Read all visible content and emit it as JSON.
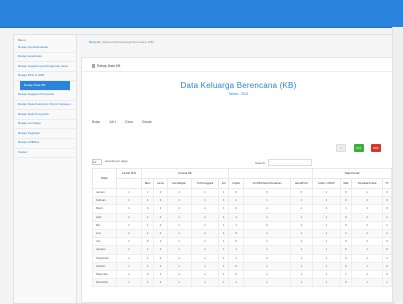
{
  "breadcrumb": {
    "home": "Beranda",
    "current": "Rekap Data Keluarga Berencana (KB)"
  },
  "panel": {
    "header": "Rekap Data KB"
  },
  "title": "Data Keluarga Berencana (KB)",
  "subtitle": "Tahun : 2011",
  "filters": {
    "bulan_label": "Bulan",
    "bulan_value": "Juli 1",
    "desa_label": "Desa",
    "desa_value": "Tokoak"
  },
  "buttons": {
    "xls": "XLS",
    "pdf": "PDF"
  },
  "tools": {
    "per_page_value": "10",
    "per_page_label": "records per page",
    "search_label": "Search:"
  },
  "sidebar": {
    "title": "Menu",
    "items": [
      {
        "label": "Rekap pendududukan"
      },
      {
        "label": "Rekap kesehatan"
      },
      {
        "label": "Rekap kegiatan pembangunan desa"
      },
      {
        "label": "Rekap PKK & LPM"
      },
      {
        "label": "Rekap Data KB"
      },
      {
        "label": "Rekap kegiatan Posyandu"
      },
      {
        "label": "Rekap Data Kelompok Tani & Nelayan"
      },
      {
        "label": "Rekap Data Posyandu"
      },
      {
        "label": "Rekap Lembaga"
      },
      {
        "label": "Rekap Kegiatan"
      },
      {
        "label": "Rekap APBDes"
      },
      {
        "label": "Keluar"
      }
    ]
  },
  "table": {
    "group_headers": [
      "Peserta KB",
      "Tidak Pernah"
    ],
    "columns": [
      "Bulan",
      "Jumlah PUS",
      "Baru",
      "Lama",
      "Kembaliyan",
      "Jml Pengganti",
      "Iud",
      "Implan",
      "Jml KB Pasca Persalinan",
      "Hamil/PUS",
      "Lebih + MKJP",
      "Wile",
      "Pemakai Kontra",
      "TT"
    ],
    "rows": [
      {
        "month": "Januari",
        "v": [
          "1",
          "1",
          "0",
          "1",
          "1",
          "1",
          "0",
          "0",
          "0",
          "1",
          "0",
          "1",
          "0"
        ]
      },
      {
        "month": "Februari",
        "v": [
          "1",
          "1",
          "0",
          "1",
          "1",
          "1",
          "1",
          "1",
          "1",
          "1",
          "0",
          "1",
          "0"
        ]
      },
      {
        "month": "Maret",
        "v": [
          "1",
          "0",
          "1",
          "1",
          "1",
          "1",
          "0",
          "1",
          "1",
          "1",
          "1",
          "1",
          "0"
        ]
      },
      {
        "month": "April",
        "v": [
          "1",
          "1",
          "0",
          "1",
          "1",
          "1",
          "1",
          "1",
          "1",
          "1",
          "0",
          "1",
          "1"
        ]
      },
      {
        "month": "Mei",
        "v": [
          "1",
          "1",
          "0",
          "1",
          "1",
          "1",
          "1",
          "0",
          "1",
          "1",
          "0",
          "1",
          "1"
        ]
      },
      {
        "month": "Juni",
        "v": [
          "1",
          "1",
          "0",
          "1",
          "1",
          "1",
          "0",
          "1",
          "1",
          "1",
          "1",
          "1",
          "1"
        ]
      },
      {
        "month": "Juli",
        "v": [
          "1",
          "0",
          "1",
          "1",
          "1",
          "1",
          "0",
          "1",
          "1",
          "1",
          "0",
          "1",
          "0"
        ]
      },
      {
        "month": "Agustus",
        "v": [
          "1",
          "1",
          "0",
          "1",
          "1",
          "1",
          "1",
          "1",
          "1",
          "1",
          "0",
          "1",
          "0"
        ]
      },
      {
        "month": "September",
        "v": [
          "1",
          "1",
          "0",
          "1",
          "1",
          "1",
          "1",
          "0",
          "1",
          "1",
          "0",
          "1",
          "1"
        ]
      },
      {
        "month": "Oktober",
        "v": [
          "1",
          "1",
          "0",
          "1",
          "1",
          "1",
          "0",
          "1",
          "1",
          "1",
          "0",
          "1",
          "0"
        ]
      },
      {
        "month": "Nopember",
        "v": [
          "1",
          "0",
          "1",
          "1",
          "1",
          "1",
          "0",
          "1",
          "1",
          "1",
          "1",
          "1",
          "0"
        ]
      },
      {
        "month": "Desember",
        "v": [
          "1",
          "1",
          "0",
          "1",
          "1",
          "1",
          "1",
          "1",
          "1",
          "1",
          "0",
          "1",
          "1"
        ]
      }
    ]
  }
}
